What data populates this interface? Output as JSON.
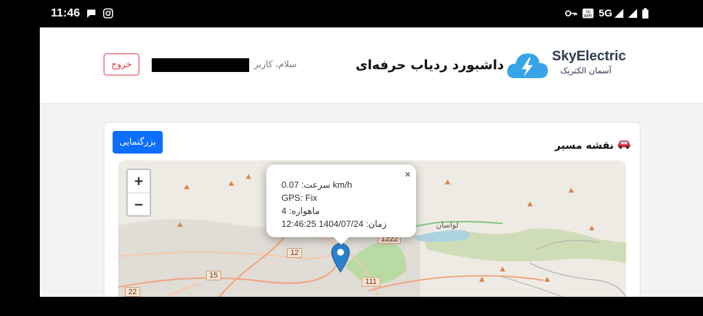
{
  "status_bar": {
    "time": "11:46",
    "network": "5G"
  },
  "header": {
    "logout_label": "خروج",
    "greeting": "سلام، کاربر",
    "dashboard_title": "داشبورد ردیاب حرفه‌ای",
    "brand_name": "SkyElectric",
    "brand_subtitle": "آسمان الکتریک"
  },
  "route_card": {
    "title": "نقشه مسیر",
    "zoom_button": "بزرگنمایی",
    "zoom_in": "+",
    "zoom_out": "−"
  },
  "popup": {
    "speed": "سرعت: 0.07 km/h",
    "gps": "GPS: Fix",
    "satellites": "ماهواره: 4",
    "time": "زمان: 1404/07/24 12:46:25",
    "close": "×"
  },
  "map_labels": {
    "road_1222": "1222",
    "road_12": "12",
    "road_15": "15",
    "road_111": "111",
    "road_22": "22",
    "place_lavasan": "لواسان"
  },
  "colors": {
    "primary": "#0d6efd",
    "danger": "#dc3545",
    "marker": "#2a81cb",
    "logo": "#38a4e8"
  }
}
